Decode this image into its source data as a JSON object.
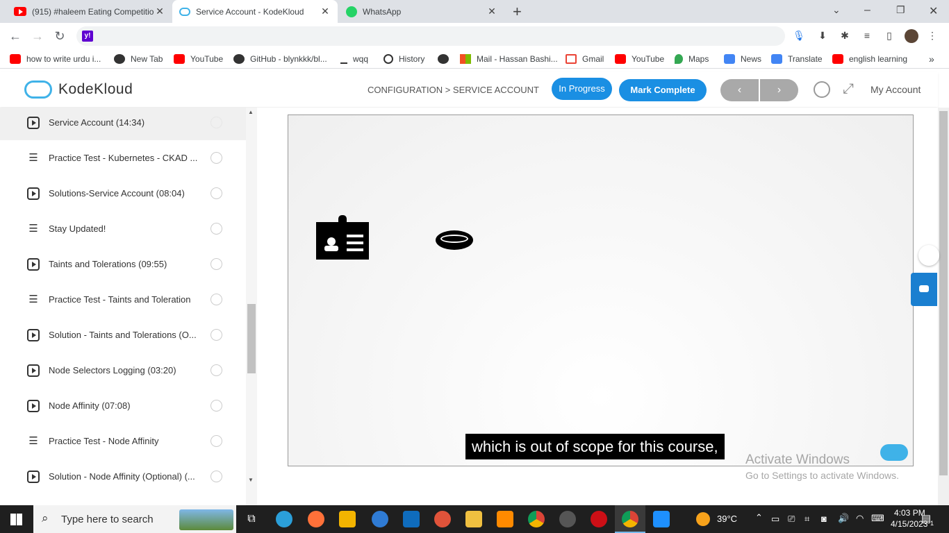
{
  "browser": {
    "tabs": [
      {
        "title": "(915) #haleem Eating Competitio",
        "favicon": "youtube-icon",
        "active": false
      },
      {
        "title": "Service Account - KodeKloud",
        "favicon": "kodekloud-icon",
        "active": true
      },
      {
        "title": "WhatsApp",
        "favicon": "whatsapp-icon",
        "active": false
      }
    ],
    "new_tab": "+",
    "window_controls": {
      "minimize": "–",
      "restore": "❐",
      "close": "✕",
      "tab_search": "⌄"
    },
    "nav": {
      "back": "←",
      "forward": "→",
      "reload": "↻"
    },
    "address_favicon": "y!"
  },
  "bookmarks": [
    {
      "label": "how to write urdu i...",
      "icon": "youtube-icon",
      "color": "#ff0000"
    },
    {
      "label": "New Tab",
      "icon": "globe-icon",
      "color": "#333333"
    },
    {
      "label": "YouTube",
      "icon": "youtube-icon",
      "color": "#ff0000"
    },
    {
      "label": "GitHub - blynkkk/bl...",
      "icon": "github-icon",
      "color": "#333333"
    },
    {
      "label": "wqq",
      "icon": "download-icon",
      "color": "#333333"
    },
    {
      "label": "History",
      "icon": "history-icon",
      "color": "#333333"
    },
    {
      "label": "",
      "icon": "globe-icon",
      "color": "#333333"
    },
    {
      "label": "Mail - Hassan Bashi...",
      "icon": "microsoft-icon",
      "color": "#f25022"
    },
    {
      "label": "Gmail",
      "icon": "gmail-icon",
      "color": "#ea4335"
    },
    {
      "label": "YouTube",
      "icon": "youtube-icon",
      "color": "#ff0000"
    },
    {
      "label": "Maps",
      "icon": "maps-icon",
      "color": "#34a853"
    },
    {
      "label": "News",
      "icon": "news-icon",
      "color": "#4285f4"
    },
    {
      "label": "Translate",
      "icon": "translate-icon",
      "color": "#4285f4"
    },
    {
      "label": "english learning",
      "icon": "youtube-icon",
      "color": "#ff0000"
    }
  ],
  "bookmarks_more": "»",
  "app": {
    "logo_text": "KodeKloud",
    "breadcrumb": "CONFIGURATION > SERVICE ACCOUNT",
    "status_label": "In Progress",
    "mark_complete_label": "Mark Complete",
    "prev": "‹",
    "next": "›",
    "my_account": "My Account",
    "accent": "#1a8fe3"
  },
  "lessons": [
    {
      "title": "Service Account (14:34)",
      "type": "video",
      "current": true
    },
    {
      "title": "Practice Test - Kubernetes - CKAD ...",
      "type": "test",
      "current": false
    },
    {
      "title": "Solutions-Service Account (08:04)",
      "type": "video",
      "current": false
    },
    {
      "title": "Stay Updated!",
      "type": "test",
      "current": false
    },
    {
      "title": "Taints and Tolerations (09:55)",
      "type": "video",
      "current": false
    },
    {
      "title": "Practice Test - Taints and Toleration",
      "type": "test",
      "current": false
    },
    {
      "title": "Solution - Taints and Tolerations (O...",
      "type": "video",
      "current": false
    },
    {
      "title": "Node Selectors Logging (03:20)",
      "type": "video",
      "current": false
    },
    {
      "title": "Node Affinity (07:08)",
      "type": "video",
      "current": false
    },
    {
      "title": "Practice Test - Node Affinity",
      "type": "test",
      "current": false
    },
    {
      "title": "Solution - Node Affinity (Optional) (...",
      "type": "video",
      "current": false
    }
  ],
  "video": {
    "caption": "which is out of scope for this course,",
    "icons": [
      "id-badge-icon",
      "token-icon"
    ]
  },
  "watermark": {
    "line1": "Activate Windows",
    "line2": "Go to Settings to activate Windows."
  },
  "taskbar": {
    "search_placeholder": "Type here to search",
    "weather": "39°C",
    "time": "4:03 PM",
    "date": "4/15/2023",
    "notifications": "1"
  }
}
